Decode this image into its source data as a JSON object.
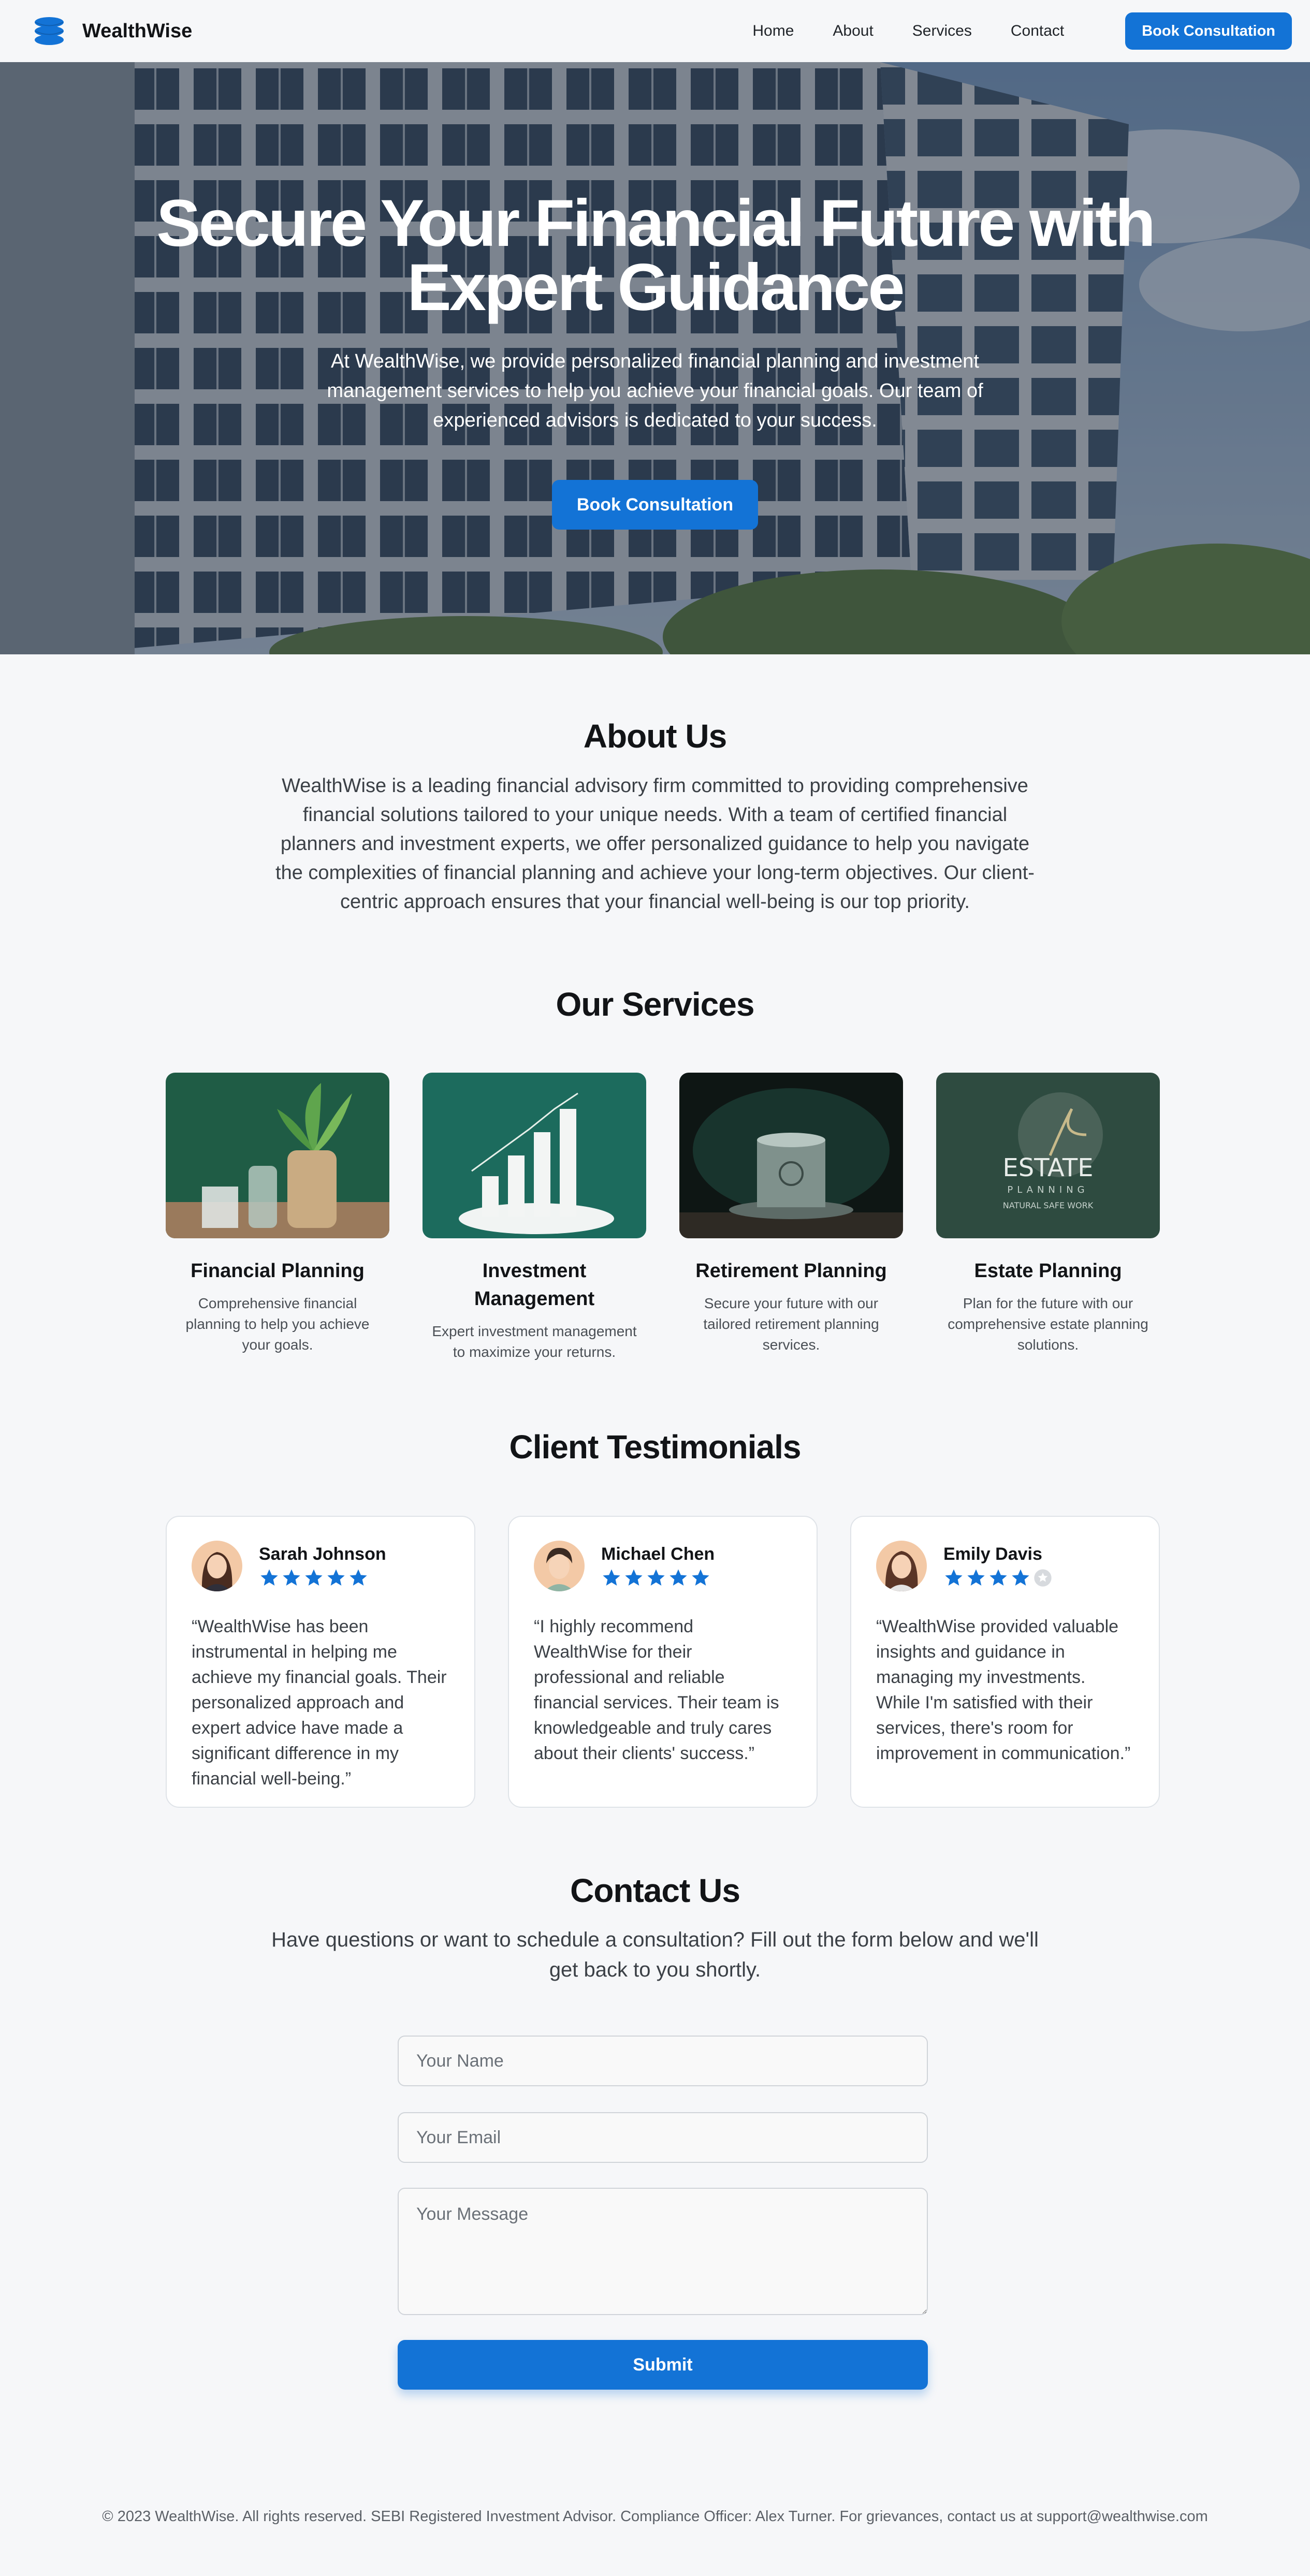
{
  "brand": {
    "name": "WealthWise",
    "logo_icon": "stacked-coins-icon"
  },
  "nav": {
    "links": [
      "Home",
      "About",
      "Services",
      "Contact"
    ],
    "cta_label": "Book Consultation"
  },
  "hero": {
    "title": "Secure Your Financial Future with Expert Guidance",
    "subtitle": "At WealthWise, we provide personalized financial planning and investment management services to help you achieve your financial goals. Our team of experienced advisors is dedicated to your success.",
    "cta_label": "Book Consultation"
  },
  "about": {
    "title": "About Us",
    "text": "WealthWise is a leading financial advisory firm committed to providing comprehensive financial solutions tailored to your unique needs. With a team of certified financial planners and investment experts, we offer personalized guidance to help you navigate the complexities of financial planning and achieve your long-term objectives. Our client-centric approach ensures that your financial well-being is our top priority."
  },
  "services": {
    "title": "Our Services",
    "items": [
      {
        "title": "Financial Planning",
        "description": "Comprehensive financial planning to help you achieve your goals."
      },
      {
        "title": "Investment Management",
        "description": "Expert investment management to maximize your returns."
      },
      {
        "title": "Retirement Planning",
        "description": "Secure your future with our tailored retirement planning services."
      },
      {
        "title": "Estate Planning",
        "description": "Plan for the future with our comprehensive estate planning solutions."
      }
    ],
    "estate_image_text": {
      "title": "ESTATE",
      "subtitle": "PLANNING",
      "tagline": "NATURAL SAFE WORK"
    }
  },
  "testimonials": {
    "title": "Client Testimonials",
    "items": [
      {
        "name": "Sarah Johnson",
        "rating": 5,
        "quote": "“WealthWise has been instrumental in helping me achieve my financial goals. Their personalized approach and expert advice have made a significant difference in my financial well-being.”"
      },
      {
        "name": "Michael Chen",
        "rating": 5,
        "quote": "“I highly recommend WealthWise for their professional and reliable financial services. Their team is knowledgeable and truly cares about their clients' success.”"
      },
      {
        "name": "Emily Davis",
        "rating": 4,
        "quote": "“WealthWise provided valuable insights and guidance in managing my investments. While I'm satisfied with their services, there's room for improvement in communication.”"
      }
    ]
  },
  "contact": {
    "title": "Contact Us",
    "subtitle": "Have questions or want to schedule a consultation? Fill out the form below and we'll get back to you shortly.",
    "name_placeholder": "Your Name",
    "email_placeholder": "Your Email",
    "message_placeholder": "Your Message",
    "submit_label": "Submit"
  },
  "footer": {
    "text": "© 2023 WealthWise. All rights reserved. SEBI Registered Investment Advisor. Compliance Officer: Alex Turner. For grievances, contact us at support@wealthwise.com"
  },
  "colors": {
    "accent": "#1373d6",
    "background": "#f6f7f9",
    "heading": "#121417",
    "body_text": "#3b4046"
  }
}
